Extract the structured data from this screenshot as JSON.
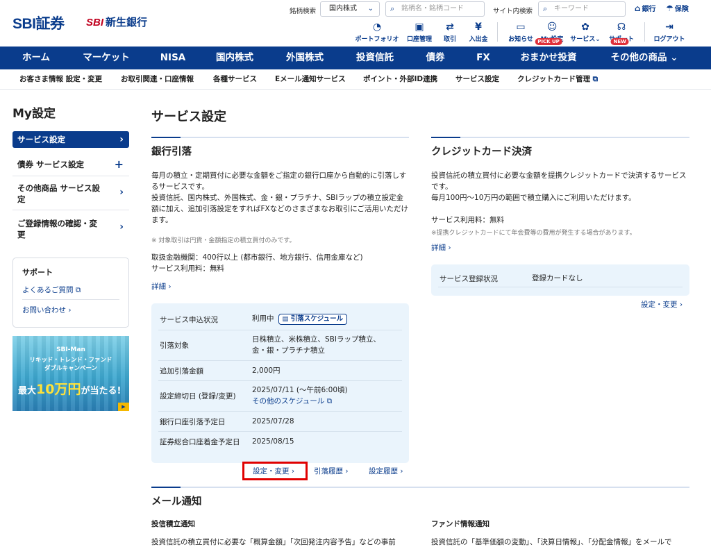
{
  "header": {
    "logo_sbi": "SBI証券",
    "logo_bank_sbi": "SBI",
    "logo_bank": "新生銀行",
    "ticker_search_label": "銘柄検索",
    "market_select": "国内株式",
    "ticker_placeholder": "銘柄名・銘柄コード",
    "site_search_label": "サイト内検索",
    "site_placeholder": "キーワード",
    "bank_link": "銀行",
    "insurance_link": "保険",
    "icons": [
      {
        "label": "ポートフォリオ",
        "icon": "portfolio-icon"
      },
      {
        "label": "口座管理",
        "icon": "account-icon"
      },
      {
        "label": "取引",
        "icon": "trade-icon"
      },
      {
        "label": "入出金",
        "icon": "deposit-icon"
      },
      {
        "label": "お知らせ",
        "icon": "notice-icon"
      },
      {
        "label": "My設定",
        "icon": "user-icon"
      },
      {
        "label": "サービス",
        "icon": "service-icon"
      },
      {
        "label": "サポート",
        "icon": "support-icon"
      },
      {
        "label": "ログアウト",
        "icon": "logout-icon"
      }
    ]
  },
  "nav": {
    "items": [
      "ホーム",
      "マーケット",
      "NISA",
      "国内株式",
      "外国株式",
      "投資信託",
      "債券",
      "FX",
      "おまかせ投資",
      "その他の商品"
    ],
    "badge_pickup": "PICK UP",
    "badge_new": "NEW"
  },
  "subnav": {
    "items": [
      "お客さま情報 設定・変更",
      "お取引関連・口座情報",
      "各種サービス",
      "Eメール通知サービス",
      "ポイント・外部ID連携",
      "サービス設定",
      "クレジットカード管理"
    ]
  },
  "sidebar": {
    "title": "My設定",
    "items": [
      "サービス設定",
      "債券 サービス設定",
      "その他商品 サービス設定",
      "ご登録情報の確認・変更"
    ],
    "support_title": "サポート",
    "support_links": [
      "よくあるご質問",
      "お問い合わせ"
    ],
    "banner": {
      "line1": "SBI-Man",
      "line2": "リキッド・トレンド・ファンド",
      "line3": "ダブルキャンペーン",
      "cta_pre": "最大",
      "cta_num": "10万円",
      "cta_post": "が当たる!"
    }
  },
  "main": {
    "page_title": "サービス設定",
    "bank": {
      "heading": "銀行引落",
      "para1": "毎月の積立・定期買付に必要な金額をご指定の銀行口座から自動的に引落しするサービスです。",
      "para2": "投資信託、国内株式、外国株式、金・銀・プラチナ、SBIラップの積立設定金額に加え、追加引落設定をすればFXなどのさまざまなお取引にご活用いただけます。",
      "note": "※ 対象取引は円貨・金額指定の積立買付のみです。",
      "info1": "取扱金融機関：400行以上 (都市銀行、地方銀行、信用金庫など)",
      "info2": "サービス利用料：無料",
      "detail_link": "詳細",
      "rows": [
        {
          "label": "サービス申込状況",
          "value": "利用中",
          "extra": "引落スケジュール"
        },
        {
          "label": "引落対象",
          "value": "日株積立、米株積立、SBIラップ積立、",
          "value2": "金・銀・プラチナ積立"
        },
        {
          "label": "追加引落金額",
          "value": "2,000円"
        },
        {
          "label": "設定締切日 (登録/変更)",
          "value": "2025/07/11 (～午前6:00頃)",
          "value2": "その他のスケジュール"
        },
        {
          "label": "銀行口座引落予定日",
          "value": "2025/07/28"
        },
        {
          "label": "証券総合口座着金予定日",
          "value": "2025/08/15"
        }
      ],
      "actions": [
        "設定・変更",
        "引落履歴",
        "設定履歴"
      ]
    },
    "credit": {
      "heading": "クレジットカード決済",
      "para1": "投資信託の積立買付に必要な金額を提携クレジットカードで決済するサービスです。",
      "para2": "毎月100円〜10万円の範囲で積立購入にご利用いただけます。",
      "info": "サービス利用料：無料",
      "note": "※提携クレジットカードにて年会費等の費用が発生する場合があります。",
      "detail_link": "詳細",
      "status_label": "サービス登録状況",
      "status_value": "登録カードなし",
      "action": "設定・変更"
    },
    "mail": {
      "heading": "メール通知",
      "col1_title": "投信積立通知",
      "col1_text": "投資信託の積立買付に必要な「概算金額」「次回発注内容予告」などの事前",
      "col2_title": "ファンド情報通知",
      "col2_text": "投資信託の「基準価額の変動」、「決算日情報」、「分配金情報」をメールで"
    }
  },
  "colors": {
    "brand": "#0a3c8c",
    "highlight": "#e00000",
    "panel": "#eaf4fc"
  }
}
